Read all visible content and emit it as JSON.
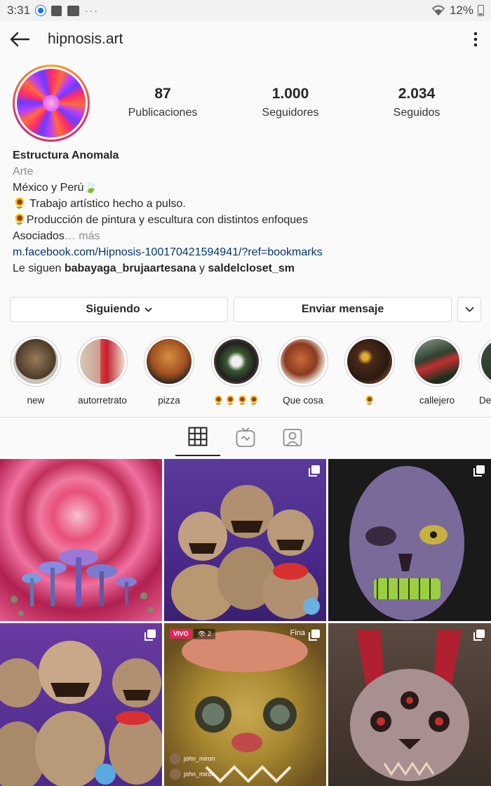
{
  "status_bar": {
    "time": "3:31",
    "dots": "···",
    "battery": "12%"
  },
  "header": {
    "username": "hipnosis.art"
  },
  "stats": {
    "posts": {
      "value": "87",
      "label": "Publicaciones"
    },
    "followers": {
      "value": "1.000",
      "label": "Seguidores"
    },
    "following": {
      "value": "2.034",
      "label": "Seguidos"
    }
  },
  "bio": {
    "name": "Estructura Anomala",
    "category": "Arte",
    "line1": "México y Perú🍃",
    "line2": "🌻 Trabajo artístico hecho a pulso.",
    "line3": "🌻Producción de pintura y escultura con distintos enfoques",
    "line4": "Asociados",
    "more": "… más",
    "link": "m.facebook.com/Hipnosis-100170421594941/?ref=bookmarks",
    "followed_by_prefix": "Le siguen ",
    "followed_by_user1": "babayaga_brujaartesana",
    "followed_by_and": " y ",
    "followed_by_user2": "saldelcloset_sm"
  },
  "actions": {
    "following_label": "Siguiendo",
    "message_label": "Enviar mensaje"
  },
  "highlights": [
    {
      "label": "new"
    },
    {
      "label": "autorretrato"
    },
    {
      "label": "pizza"
    },
    {
      "label": "🌻🌻🌻🌻"
    },
    {
      "label": "Que cosa"
    },
    {
      "label": "🌻"
    },
    {
      "label": "callejero"
    },
    {
      "label": "De"
    }
  ],
  "posts": [
    {
      "multi": false
    },
    {
      "multi": true
    },
    {
      "multi": true
    },
    {
      "multi": true
    },
    {
      "multi": true,
      "live": "VIVO",
      "viewers": "2",
      "overlay_text": "Fina",
      "commenter1": "john_miron",
      "commenter2": "john_miron"
    },
    {
      "multi": true
    }
  ],
  "icons": {
    "back": "arrow-left-icon",
    "more": "vertical-dots-icon",
    "grid": "grid-icon",
    "igtv": "igtv-icon",
    "tagged": "tagged-person-icon"
  }
}
